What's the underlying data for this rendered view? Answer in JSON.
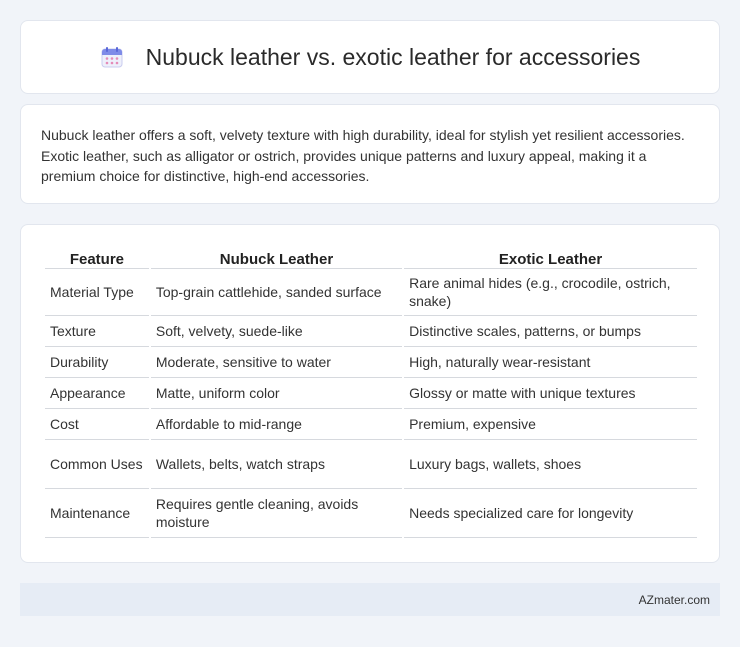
{
  "header": {
    "title": "Nubuck leather vs. exotic leather for accessories",
    "icon": "calendar-icon"
  },
  "intro": {
    "text": "Nubuck leather offers a soft, velvety texture with high durability, ideal for stylish yet resilient accessories. Exotic leather, such as alligator or ostrich, provides unique patterns and luxury appeal, making it a premium choice for distinctive, high-end accessories."
  },
  "table": {
    "headers": [
      "Feature",
      "Nubuck Leather",
      "Exotic Leather"
    ],
    "rows": [
      [
        "Material Type",
        "Top-grain cattlehide, sanded surface",
        "Rare animal hides (e.g., crocodile, ostrich, snake)"
      ],
      [
        "Texture",
        "Soft, velvety, suede-like",
        "Distinctive scales, patterns, or bumps"
      ],
      [
        "Durability",
        "Moderate, sensitive to water",
        "High, naturally wear-resistant"
      ],
      [
        "Appearance",
        "Matte, uniform color",
        "Glossy or matte with unique textures"
      ],
      [
        "Cost",
        "Affordable to mid-range",
        "Premium, expensive"
      ],
      [
        "Common Uses",
        "Wallets, belts, watch straps",
        "Luxury bags, wallets, shoes"
      ],
      [
        "Maintenance",
        "Requires gentle cleaning, avoids moisture",
        "Needs specialized care for longevity"
      ]
    ]
  },
  "footer": {
    "text": "AZmater.com"
  }
}
